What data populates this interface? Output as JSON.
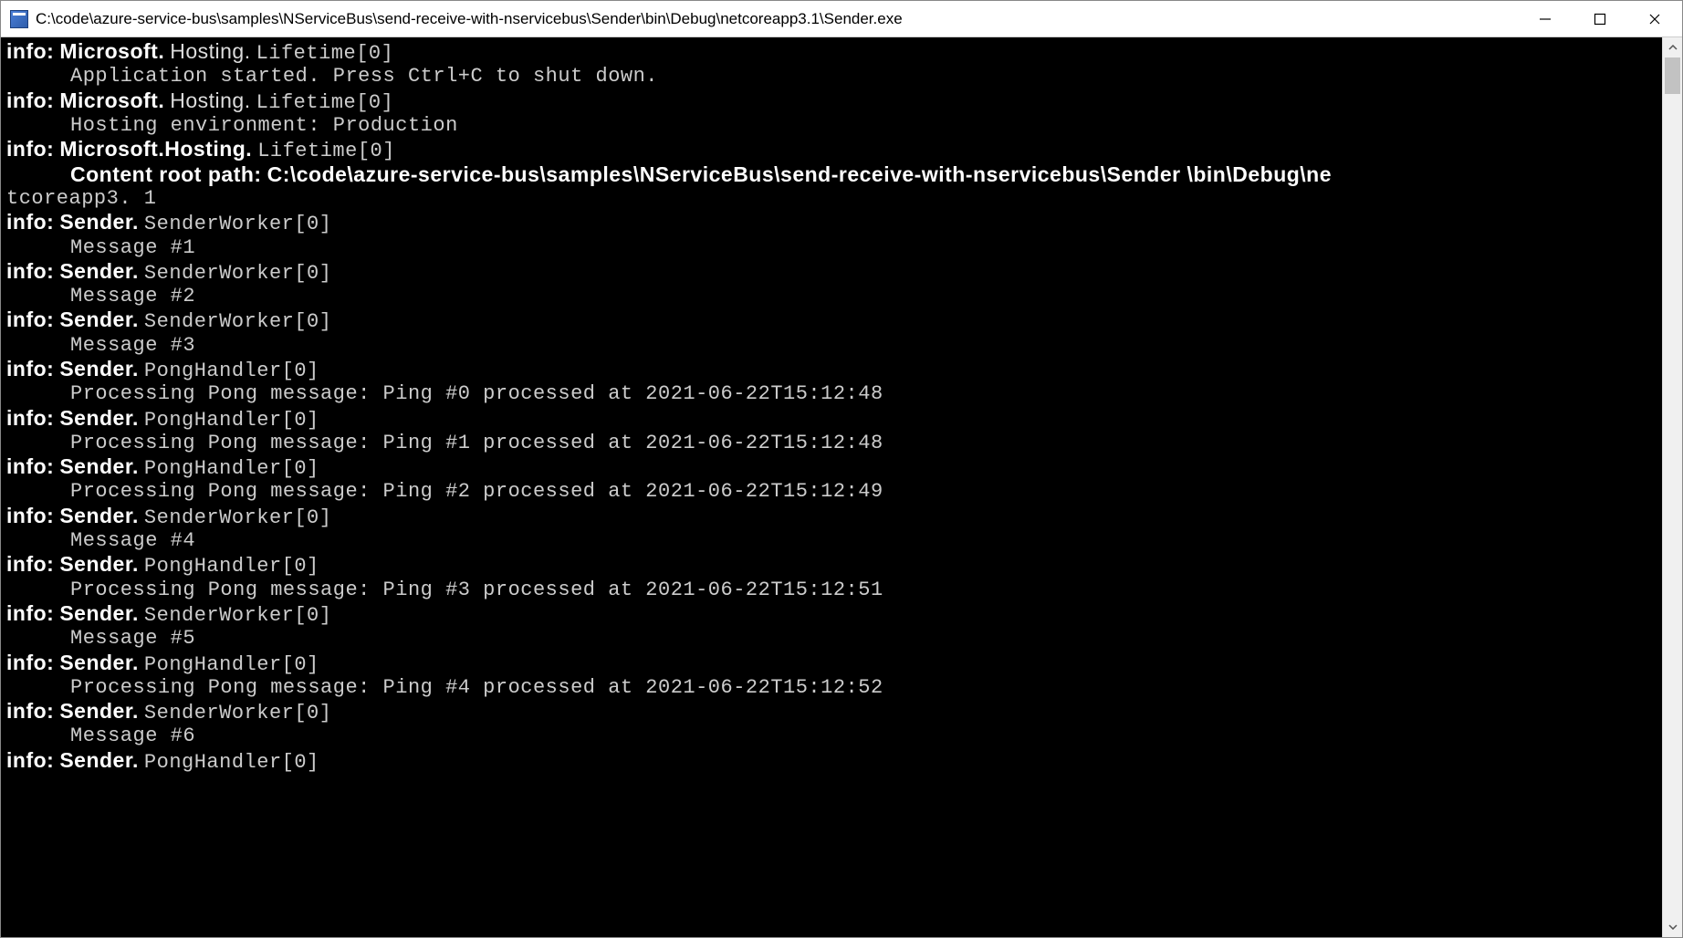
{
  "window": {
    "title": "C:\\code\\azure-service-bus\\samples\\NServiceBus\\send-receive-with-nservicebus\\Sender\\bin\\Debug\\netcoreapp3.1\\Sender.exe"
  },
  "console": {
    "entries": [
      {
        "level": "info:",
        "src1": "Microsoft.",
        "src2": "Hosting.",
        "cls": "Lifetime[0]",
        "msg": "Application started. Press Ctrl+C to shut down."
      },
      {
        "level": "info:",
        "src1": "Microsoft.",
        "src2": "Hosting.",
        "cls": "Lifetime[0]",
        "msg": "Hosting environment: Production"
      },
      {
        "level": "info:",
        "src1": "Microsoft.Hosting.",
        "src2": "",
        "cls": "Lifetime[0]",
        "msg_prefix": "Content root path:",
        "msg_path": "C:\\code\\azure-service-bus\\samples\\NServiceBus\\send-receive-with-nservicebus\\Sender \\bin\\Debug\\ne",
        "msg_wrap": "tcoreapp3. 1"
      },
      {
        "level": "info:",
        "src1": "Sender.",
        "src2": "",
        "cls": "SenderWorker[0]",
        "msg": "Message #1"
      },
      {
        "level": "info:",
        "src1": "Sender.",
        "src2": "",
        "cls": "SenderWorker[0]",
        "msg": "Message #2"
      },
      {
        "level": "info:",
        "src1": "Sender.",
        "src2": "",
        "cls": "SenderWorker[0]",
        "msg": "Message #3"
      },
      {
        "level": "info:",
        "src1": "Sender.",
        "src2": "",
        "cls": "PongHandler[0]",
        "msg": "Processing Pong message: Ping #0 processed at 2021-06-22T15:12:48"
      },
      {
        "level": "info:",
        "src1": "Sender.",
        "src2": "",
        "cls": "PongHandler[0]",
        "msg": "Processing Pong message: Ping #1 processed at 2021-06-22T15:12:48"
      },
      {
        "level": "info:",
        "src1": "Sender.",
        "src2": "",
        "cls": "PongHandler[0]",
        "msg": "Processing Pong message: Ping #2 processed at 2021-06-22T15:12:49"
      },
      {
        "level": "info:",
        "src1": "Sender.",
        "src2": "",
        "cls": "SenderWorker[0]",
        "msg": "Message #4"
      },
      {
        "level": "info:",
        "src1": "Sender.",
        "src2": "",
        "cls": "PongHandler[0]",
        "msg": "Processing Pong message: Ping #3 processed at 2021-06-22T15:12:51"
      },
      {
        "level": "info:",
        "src1": "Sender.",
        "src2": "",
        "cls": "SenderWorker[0]",
        "msg": "Message #5"
      },
      {
        "level": "info:",
        "src1": "Sender.",
        "src2": "",
        "cls": "PongHandler[0]",
        "msg": "Processing Pong message: Ping #4 processed at 2021-06-22T15:12:52"
      },
      {
        "level": "info:",
        "src1": "Sender.",
        "src2": "",
        "cls": "SenderWorker[0]",
        "msg": "Message #6"
      },
      {
        "level": "info:",
        "src1": "Sender.",
        "src2": "",
        "cls": "PongHandler[0]",
        "msg": ""
      }
    ]
  }
}
